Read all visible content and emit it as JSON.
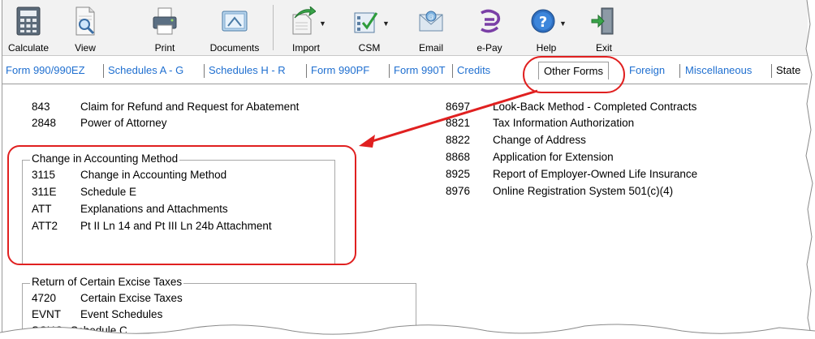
{
  "toolbar": {
    "buttons": [
      {
        "label": "Calculate"
      },
      {
        "label": "View"
      },
      {
        "label": "Print"
      },
      {
        "label": "Documents"
      },
      {
        "label": "Import"
      },
      {
        "label": "CSM"
      },
      {
        "label": "Email"
      },
      {
        "label": "e-Pay"
      },
      {
        "label": "Help"
      },
      {
        "label": "Exit"
      }
    ]
  },
  "tabs": [
    {
      "label": "Form 990/990EZ"
    },
    {
      "label": "Schedules A - G"
    },
    {
      "label": "Schedules H - R"
    },
    {
      "label": "Form 990PF"
    },
    {
      "label": "Form 990T"
    },
    {
      "label": "Credits"
    },
    {
      "label": "Other Forms"
    },
    {
      "label": "Foreign"
    },
    {
      "label": "Miscellaneous"
    },
    {
      "label": "State"
    }
  ],
  "left_forms": [
    {
      "code": "843",
      "name": "Claim for Refund and Request for Abatement"
    },
    {
      "code": "2848",
      "name": "Power of Attorney"
    }
  ],
  "accounting_group": {
    "title": "Change in Accounting Method",
    "items": [
      {
        "code": "3115",
        "name": "Change in Accounting Method"
      },
      {
        "code": "311E",
        "name": "Schedule E"
      },
      {
        "code": "ATT",
        "name": "Explanations and Attachments"
      },
      {
        "code": "ATT2",
        "name": "Pt II Ln 14 and Pt III Ln 24b Attachment"
      }
    ]
  },
  "excise_group": {
    "title": "Return of Certain Excise Taxes",
    "items": [
      {
        "code": "4720",
        "name": "Certain Excise Taxes"
      },
      {
        "code": "EVNT",
        "name": "Event Schedules"
      },
      {
        "code": "SCHC",
        "name": "Schedule C"
      }
    ]
  },
  "right_forms": [
    {
      "code": "8697",
      "name": "Look-Back Method - Completed Contracts"
    },
    {
      "code": "8821",
      "name": "Tax Information Authorization"
    },
    {
      "code": "8822",
      "name": "Change of Address"
    },
    {
      "code": "8868",
      "name": "Application for Extension"
    },
    {
      "code": "8925",
      "name": "Report of Employer-Owned Life Insurance"
    },
    {
      "code": "8976",
      "name": "Online Registration System 501(c)(4)"
    }
  ],
  "colors": {
    "annotation": "#e02020",
    "tab_link": "#1f6fd0"
  }
}
